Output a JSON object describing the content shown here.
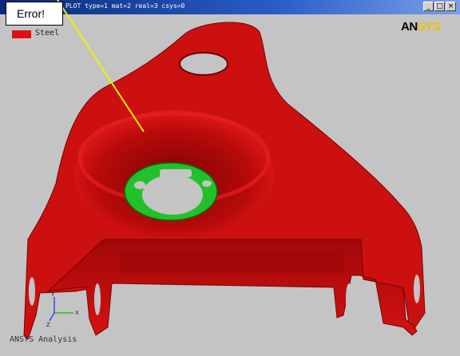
{
  "window": {
    "title": "PLOT  type=1 mat=2 real=3 csys=0",
    "controls": {
      "minimize": "_",
      "maximize": "□",
      "close": "×"
    }
  },
  "legend": {
    "label": "Steel",
    "color": "#e01010"
  },
  "logo": {
    "part1": "AN",
    "part2": "SYS"
  },
  "footer": "ANSYS Analysis",
  "callout": {
    "text": "Error!"
  },
  "colors": {
    "part": "#c41010",
    "hole_ring": "#22c02a",
    "pointer": "#f0f000",
    "background": "#c4c4c4"
  },
  "icons": {
    "triad": "xyz-triad-icon"
  }
}
